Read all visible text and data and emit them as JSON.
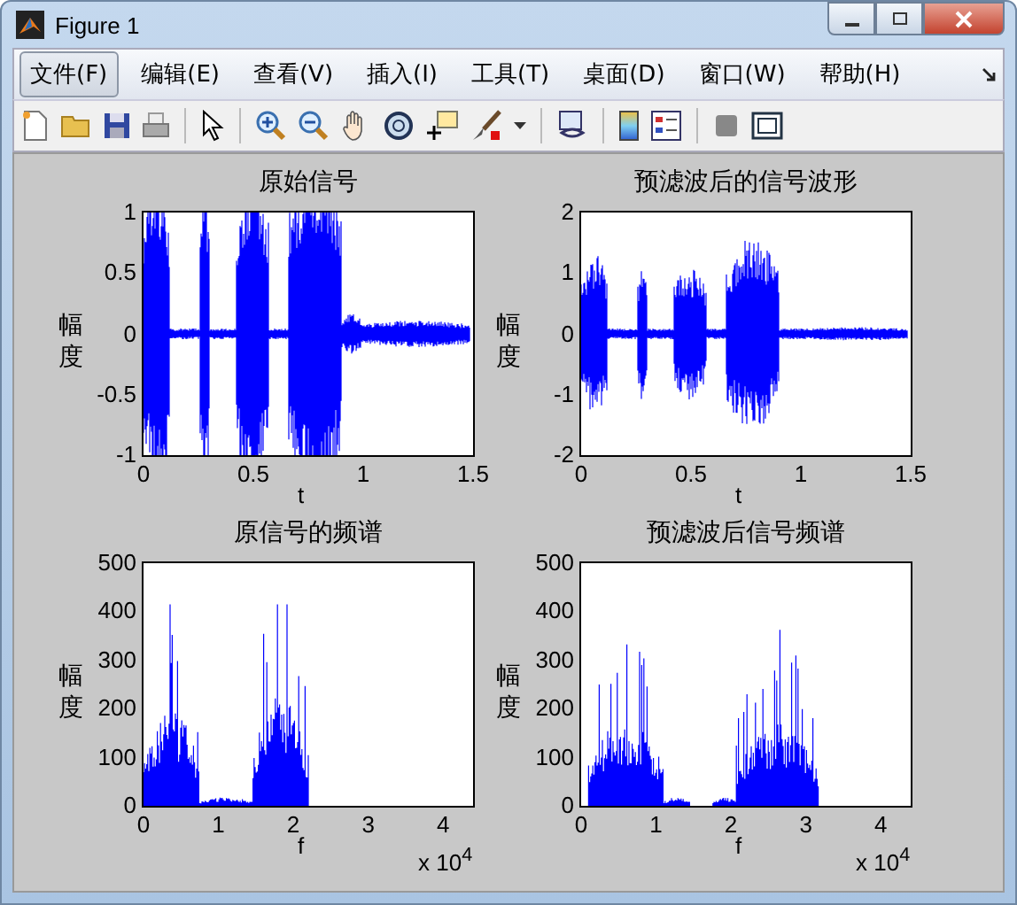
{
  "window": {
    "title": "Figure 1"
  },
  "menu": [
    {
      "label": "文件(F)",
      "selected": true
    },
    {
      "label": "编辑(E)",
      "selected": false
    },
    {
      "label": "查看(V)",
      "selected": false
    },
    {
      "label": "插入(I)",
      "selected": false
    },
    {
      "label": "工具(T)",
      "selected": false
    },
    {
      "label": "桌面(D)",
      "selected": false
    },
    {
      "label": "窗口(W)",
      "selected": false
    },
    {
      "label": "帮助(H)",
      "selected": false
    }
  ],
  "plots": [
    {
      "kind": "wave",
      "title": "原始信号",
      "ylabel": "幅度",
      "xlabel": "t",
      "xticks": [
        "0",
        "0.5",
        "1",
        "1.5"
      ],
      "yticks": [
        "1",
        "0.5",
        "0",
        "-0.5",
        "-1"
      ]
    },
    {
      "kind": "wave",
      "title": "预滤波后的信号波形",
      "ylabel": "幅度",
      "xlabel": "t",
      "xticks": [
        "0",
        "0.5",
        "1",
        "1.5"
      ],
      "yticks": [
        "2",
        "1",
        "0",
        "-1",
        "-2"
      ]
    },
    {
      "kind": "spectrum",
      "title": "原信号的频谱",
      "ylabel": "幅度",
      "xlabel": "f",
      "xticks": [
        "0",
        "1",
        "2",
        "3",
        "4"
      ],
      "yticks": [
        "500",
        "400",
        "300",
        "200",
        "100",
        "0"
      ],
      "exponent": "x 10$^{4}$"
    },
    {
      "kind": "spectrum",
      "title": "预滤波后信号频谱",
      "ylabel": "幅度",
      "xlabel": "f",
      "xticks": [
        "0",
        "1",
        "2",
        "3",
        "4"
      ],
      "yticks": [
        "500",
        "400",
        "300",
        "200",
        "100",
        "0"
      ],
      "exponent": "x 10$^{4}$"
    }
  ]
}
